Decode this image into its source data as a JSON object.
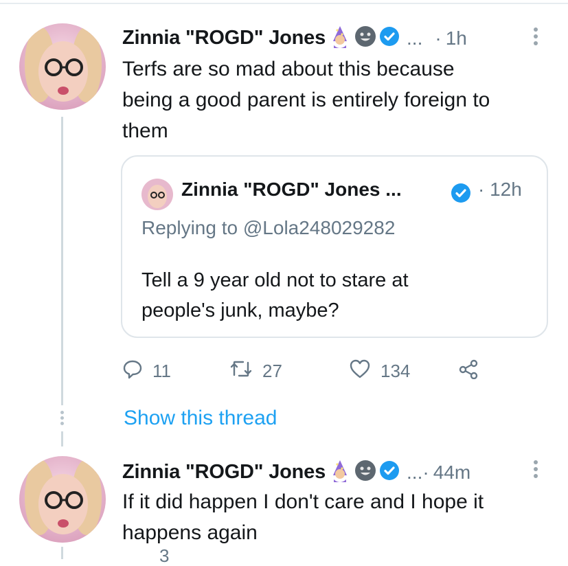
{
  "tweets": [
    {
      "author": "Zinnia \"ROGD\" Jones",
      "ellipsis": "...",
      "separator": "·",
      "time": "1h",
      "text_lines": [
        "Terfs are so mad about this because",
        "being a good parent is entirely foreign to",
        "them"
      ],
      "quote": {
        "author": "Zinnia \"ROGD\" Jones ...",
        "time": "· 12h",
        "replying_prefix": "Replying to ",
        "replying_handle": "@Lola248029282",
        "text_lines": [
          "Tell a 9 year old not to stare at",
          "people's junk, maybe?"
        ]
      },
      "actions": {
        "reply_count": "11",
        "retweet_count": "27",
        "like_count": "134"
      },
      "show_thread": "Show this thread"
    },
    {
      "author": "Zinnia \"ROGD\" Jones",
      "ellipsis": "...",
      "separator": "·",
      "time": "44m",
      "text_lines": [
        "If it did happen I don't care and I hope it",
        "happens again"
      ],
      "cut_off_count": "3"
    }
  ],
  "icons": [
    "wizard-emoji-icon",
    "grinning-face-icon",
    "verified-badge-icon",
    "more-options-icon",
    "reply-icon",
    "retweet-icon",
    "like-icon",
    "share-icon"
  ],
  "colors": {
    "accent": "#1da1f2",
    "verified": "#1d9bf0",
    "muted": "#657786",
    "text": "#14171a"
  }
}
